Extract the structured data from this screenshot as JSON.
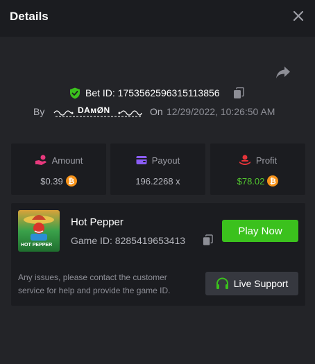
{
  "header": {
    "title": "Details"
  },
  "bet": {
    "id_label": "Bet ID: 1753562596315113856",
    "by_label": "By",
    "username": "DAмØN",
    "on_label": "On",
    "date": "12/29/2022, 10:26:50 AM"
  },
  "stats": {
    "amount": {
      "label": "Amount",
      "value": "$0.39",
      "icon": "hand-coins-icon",
      "currency_icon": "bitcoin-icon"
    },
    "payout": {
      "label": "Payout",
      "value": "196.2268 x",
      "icon": "wallet-icon"
    },
    "profit": {
      "label": "Profit",
      "value": "$78.02",
      "icon": "money-hand-icon",
      "currency_icon": "bitcoin-icon"
    }
  },
  "game": {
    "name": "Hot Pepper",
    "id_label": "Game ID: 8285419653413",
    "thumbnail_text": "HOT PEPPER",
    "play_label": "Play Now",
    "help_text": "Any issues, please contact the customer service for help and provide the game ID.",
    "support_label": "Live Support"
  },
  "colors": {
    "background": "#232428",
    "panel": "#1b1c20",
    "accent_green": "#3bc11d",
    "profit_green": "#52c72f",
    "bitcoin": "#f7931a"
  }
}
